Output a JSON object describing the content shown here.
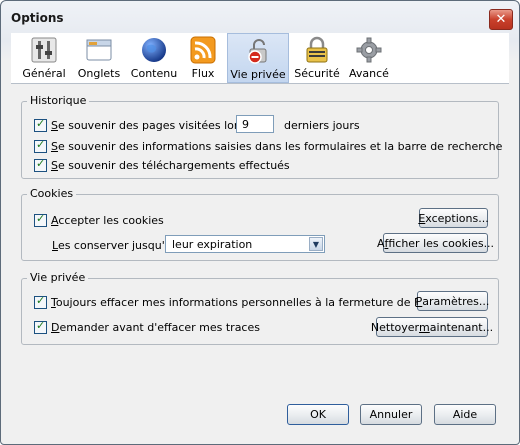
{
  "window": {
    "title": "Options"
  },
  "tabs": [
    {
      "label": "Général",
      "icon": "general-switches-icon"
    },
    {
      "label": "Onglets",
      "icon": "tabs-window-icon"
    },
    {
      "label": "Contenu",
      "icon": "globe-icon"
    },
    {
      "label": "Flux",
      "icon": "rss-feed-icon"
    },
    {
      "label": "Vie privée",
      "icon": "privacy-lock-icon",
      "selected": true
    },
    {
      "label": "Sécurité",
      "icon": "padlock-icon"
    },
    {
      "label": "Avancé",
      "icon": "gear-icon"
    }
  ],
  "historique": {
    "title": "Historique",
    "visited_pre": "e souvenir des pages visitées lors des",
    "visited_key": "S",
    "days_value": "9",
    "days_suffix": "derniers jours",
    "forms_pre": "e souvenir des informations saisies dans les formulaires et la barre de recherche",
    "forms_key": "S",
    "downloads_pre": "e souvenir des téléchargements effectués",
    "downloads_key": "S"
  },
  "cookies": {
    "title": "Cookies",
    "accept_key": "A",
    "accept_rest": "ccepter les cookies",
    "keep_key": "L",
    "keep_rest": "es conserver jusqu'à :",
    "keep_value": "leur expiration",
    "exceptions_button": "Exceptions...",
    "exceptions_key": "E",
    "show_button_pre": "A",
    "show_button_key": "f",
    "show_button_rest": "ficher les cookies..."
  },
  "vie_privee": {
    "title": "Vie privée",
    "clear_key": "T",
    "clear_rest": "oujours effacer mes informations personnelles à la fermeture de Firefox",
    "ask_key": "D",
    "ask_rest": "emander avant d'effacer mes traces",
    "params_button_key": "P",
    "params_button_rest": "aramètres...",
    "clear_now_pre": "Nettoyer ",
    "clear_now_key": "m",
    "clear_now_rest": "aintenant..."
  },
  "footer": {
    "ok": "OK",
    "cancel": "Annuler",
    "help": "Aide"
  },
  "colors": {
    "accent": "#c3d6ef",
    "close": "#c9412c"
  }
}
